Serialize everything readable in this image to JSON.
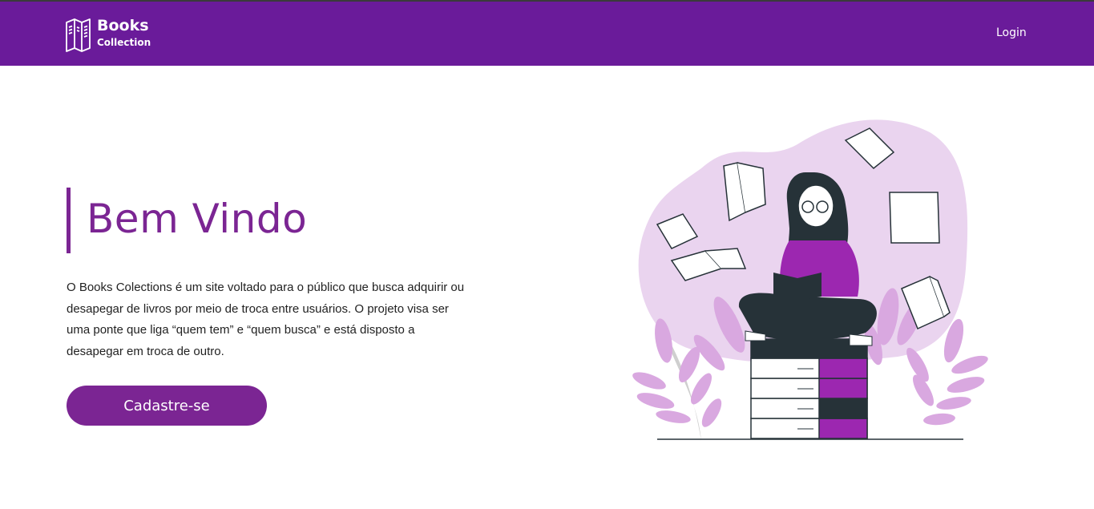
{
  "header": {
    "logo_title": "Books",
    "logo_subtitle": "Collection",
    "login_label": "Login"
  },
  "hero": {
    "title": "Bem Vindo",
    "description": "O Books Colections é um site voltado para o público que busca adquirir ou desapegar de livros por meio de troca entre usuários. O projeto visa ser uma ponte que liga “quem tem” e “quem busca” e está disposto a desapegar em troca de outro.",
    "cta_label": "Cadastre-se"
  },
  "colors": {
    "header_bg": "#6a1b9a",
    "accent": "#7b2593",
    "blob": "#ead4ef",
    "leaf": "#d9a8e0",
    "dark": "#263238"
  },
  "icons": {
    "logo": "books-icon"
  }
}
